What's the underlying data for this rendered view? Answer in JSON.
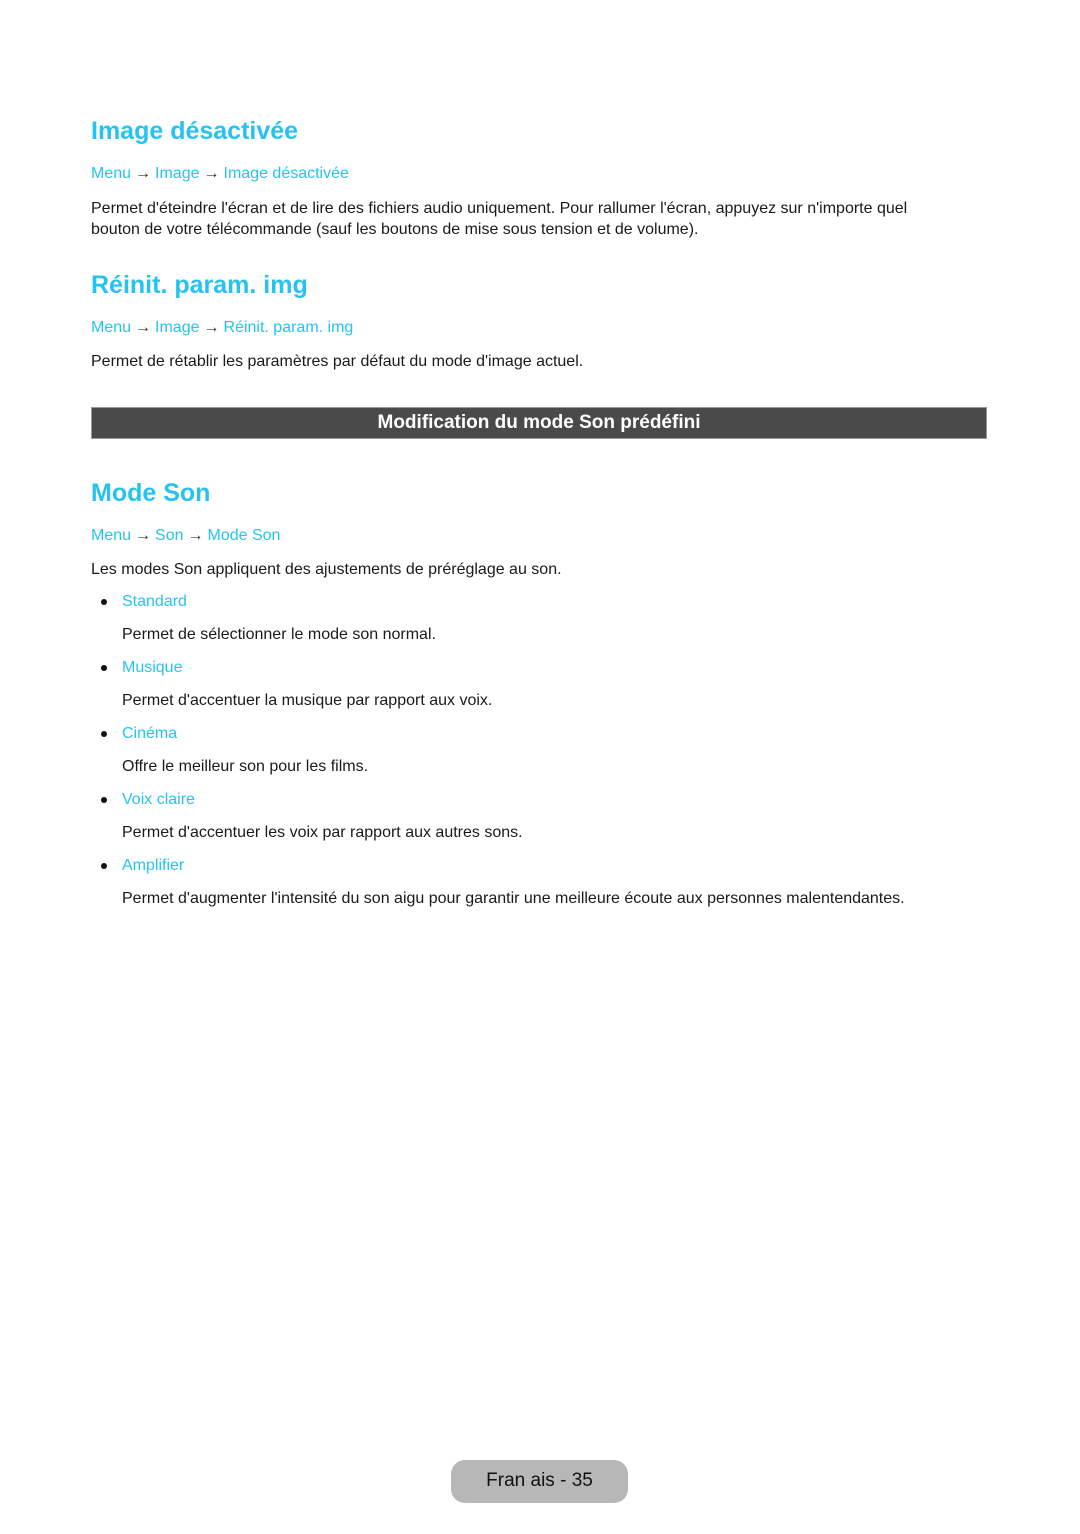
{
  "sections": [
    {
      "title": "Image désactivée",
      "path": [
        "Menu",
        "Image",
        "Image désactivée"
      ],
      "text_lines": [
        "Permet d'éteindre l'écran et de lire des fichiers audio uniquement. Pour rallumer l'écran, appuyez sur n'importe quel",
        "bouton de votre télécommande (sauf les boutons de mise sous tension et de volume)."
      ]
    },
    {
      "title": "Réinit. param. img",
      "path": [
        "Menu",
        "Image",
        "Réinit. param. img"
      ],
      "text_lines": [
        "Permet de rétablir les paramètres par défaut du mode d'image actuel."
      ]
    }
  ],
  "banner": "Modification du mode Son prédéfini",
  "mode_son": {
    "title": "Mode Son",
    "path": [
      "Menu",
      "Son",
      "Mode Son"
    ],
    "intro": "Les modes Son appliquent des ajustements de préréglage au son.",
    "items": [
      {
        "label": "Standard",
        "desc": "Permet de sélectionner le mode son normal."
      },
      {
        "label": "Musique",
        "desc": "Permet d'accentuer la musique par rapport aux voix."
      },
      {
        "label": "Cinéma",
        "desc": "Offre le meilleur son pour les films."
      },
      {
        "label": "Voix claire",
        "desc": "Permet d'accentuer les voix par rapport aux autres sons."
      },
      {
        "label": "Amplifier",
        "desc": "Permet d'augmenter l'intensité du son aigu pour garantir une meilleure écoute aux personnes malentendantes."
      }
    ]
  },
  "arrow": "→",
  "footer": "Fran ais - 35"
}
